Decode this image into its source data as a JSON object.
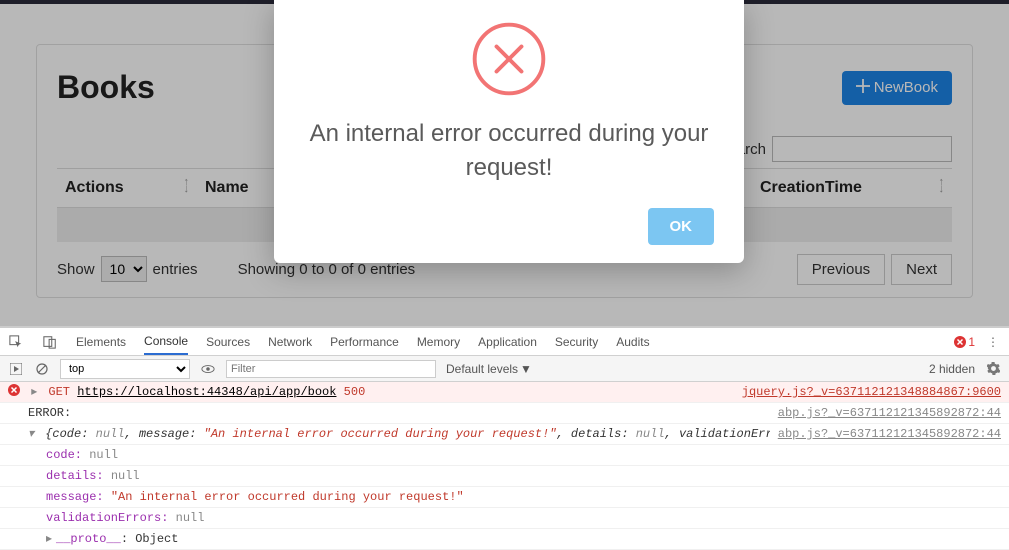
{
  "page": {
    "title": "Books",
    "newButton": "NewBook",
    "searchLabel": "arch",
    "columns": {
      "actions": "Actions",
      "name": "Name",
      "creationTime": "CreationTime"
    },
    "showPrefix": "Show",
    "showSuffix": "entries",
    "pageSize": "10",
    "info": "Showing 0 to 0 of 0 entries",
    "prev": "Previous",
    "next": "Next"
  },
  "modal": {
    "message": "An internal error occurred during your request!",
    "ok": "OK"
  },
  "devtools": {
    "tabs": {
      "elements": "Elements",
      "console": "Console",
      "sources": "Sources",
      "network": "Network",
      "performance": "Performance",
      "memory": "Memory",
      "application": "Application",
      "security": "Security",
      "audits": "Audits"
    },
    "errorCount": "1",
    "context": "top",
    "filterPlaceholder": "Filter",
    "levels": "Default levels",
    "hidden": "2 hidden",
    "log": {
      "req": {
        "method": "GET",
        "url": "https://localhost:44348/api/app/book",
        "status": "500",
        "src": "jquery.js?_v=637112121348884867:9600"
      },
      "errLabel": "ERROR:",
      "errSrc": "abp.js?_v=637112121345892872:44",
      "obj": {
        "summary": "{code: null, message: \"An internal error occurred during your request!\", details: null, validationErrors: null}",
        "code": "code:",
        "codeVal": "null",
        "details": "details:",
        "detailsVal": "null",
        "message": "message:",
        "messageVal": "\"An internal error occurred during your request!\"",
        "validationErrors": "validationErrors:",
        "validationErrorsVal": "null",
        "proto": "__proto__",
        "protoVal": ": Object"
      },
      "objSrc": "abp.js?_v=637112121345892872:44"
    }
  }
}
